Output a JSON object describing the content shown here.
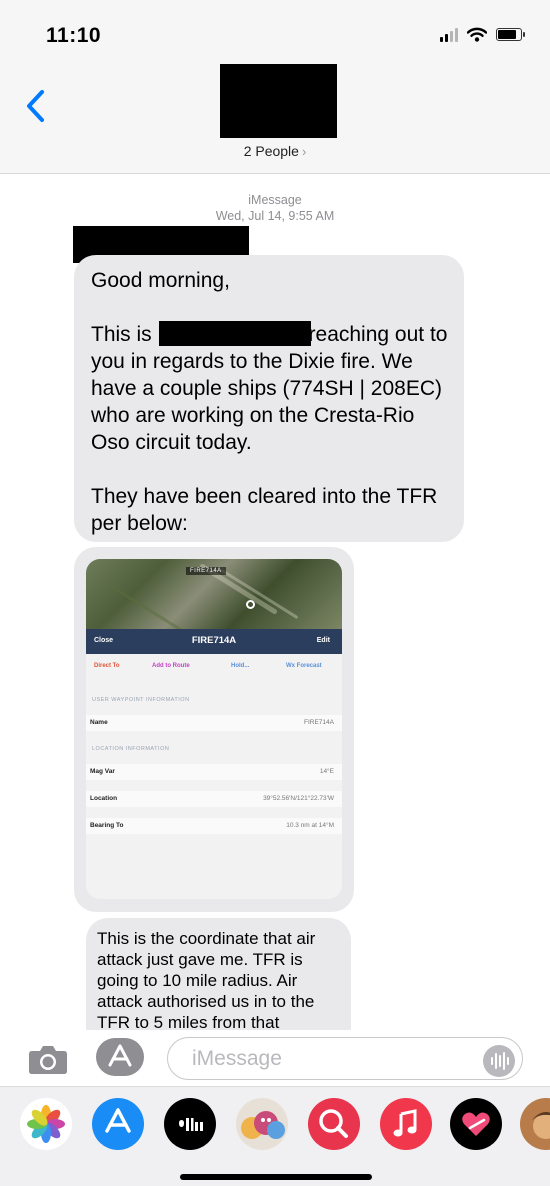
{
  "status_bar": {
    "time": "11:10"
  },
  "header": {
    "people_label": "2 People",
    "people_chevron": "›"
  },
  "conversation": {
    "service": "iMessage",
    "date": "Wed, Jul 14, 9:55 AM",
    "message1": {
      "greeting": "Good morning,",
      "line_this_is": "This is",
      "line_reaching": "reaching out to you in regards to the Dixie fire. We have a couple ships (774SH | 208EC) who are working on the Cresta-Rio Oso circuit today.",
      "line_cleared": "They have been cleared into the TFR per below:"
    },
    "attachment": {
      "map_label": "FIRE714A",
      "close": "Close",
      "title": "FIRE714A",
      "edit": "Edit",
      "actions": [
        "Direct To",
        "Add to Route",
        "Hold...",
        "Wx Forecast"
      ],
      "section_waypoint": "USER WAYPOINT INFORMATION",
      "name_label": "Name",
      "name_value": "FIRE714A",
      "section_location": "LOCATION INFORMATION",
      "magvar_label": "Mag Var",
      "magvar_value": "14°E",
      "location_label": "Location",
      "location_value": "39°52.56'N/121°22.73'W",
      "bearing_label": "Bearing To",
      "bearing_value": "10.3 nm at 14°M"
    },
    "message2": {
      "text": "This is the coordinate that air attack just gave me. TFR is going to 10 mile radius. Air attack authorised us in to the TFR to 5 miles from that"
    }
  },
  "compose": {
    "placeholder": "iMessage"
  },
  "colors": {
    "accent": "#007aff",
    "bubble": "#e9e9eb",
    "redaction": "#000000"
  }
}
